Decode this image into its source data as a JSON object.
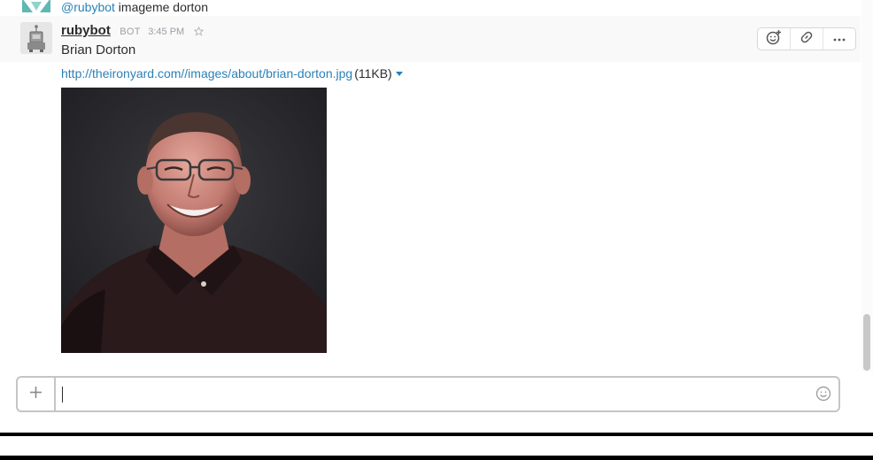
{
  "previous_message": {
    "mention": "@rubybot",
    "command": " imageme dorton"
  },
  "message": {
    "sender": "rubybot",
    "badge": "BOT",
    "time": "3:45 PM",
    "text": "Brian Dorton",
    "attachment": {
      "url": "http://theironyard.com//images/about/brian-dorton.jpg",
      "size": "(11KB)"
    },
    "image_alt": "Brian Dorton photo"
  },
  "actions": {
    "icons": [
      "add-reaction-icon",
      "link-icon",
      "more-icon"
    ]
  },
  "composer": {
    "value": "",
    "placeholder": ""
  },
  "colors": {
    "link": "#2a80b9",
    "text": "#2c2d30",
    "muted": "#9e9ea6",
    "image_bg": "#2c2a2c",
    "shirt": "#2b1a1c"
  }
}
